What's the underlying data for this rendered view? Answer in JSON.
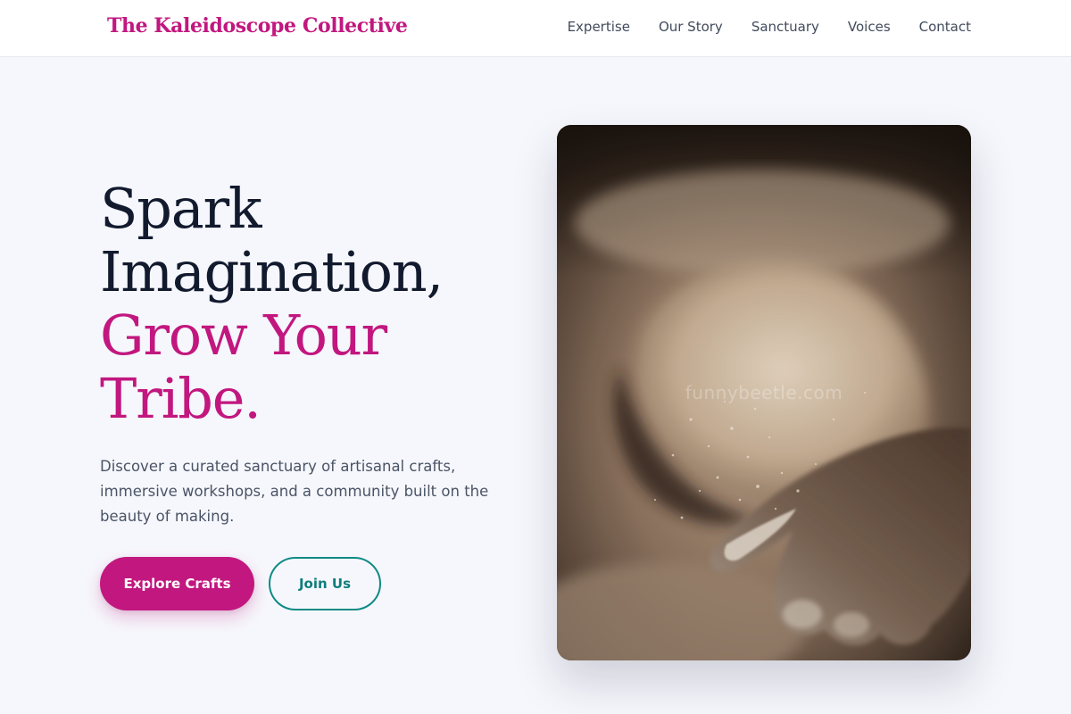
{
  "brand": {
    "name": "The Kaleidoscope Collective"
  },
  "nav": {
    "items": [
      {
        "label": "Expertise"
      },
      {
        "label": "Our Story"
      },
      {
        "label": "Sanctuary"
      },
      {
        "label": "Voices"
      },
      {
        "label": "Contact"
      }
    ]
  },
  "hero": {
    "title_line1": "Spark",
    "title_line2": "Imagination,",
    "title_accent_line1": "Grow Your",
    "title_accent_line2": "Tribe.",
    "subtitle": "Discover a curated sanctuary of artisanal crafts, immersive workshops, and a community built on the beauty of making.",
    "primary_button": "Explore Crafts",
    "secondary_button": "Join Us",
    "image_watermark": "funnybeetle.com"
  },
  "colors": {
    "accent": "#c2177f",
    "secondary": "#0f8a85",
    "heading": "#121a2e",
    "body_text": "#4a5466",
    "page_background": "#f6f7fc"
  }
}
